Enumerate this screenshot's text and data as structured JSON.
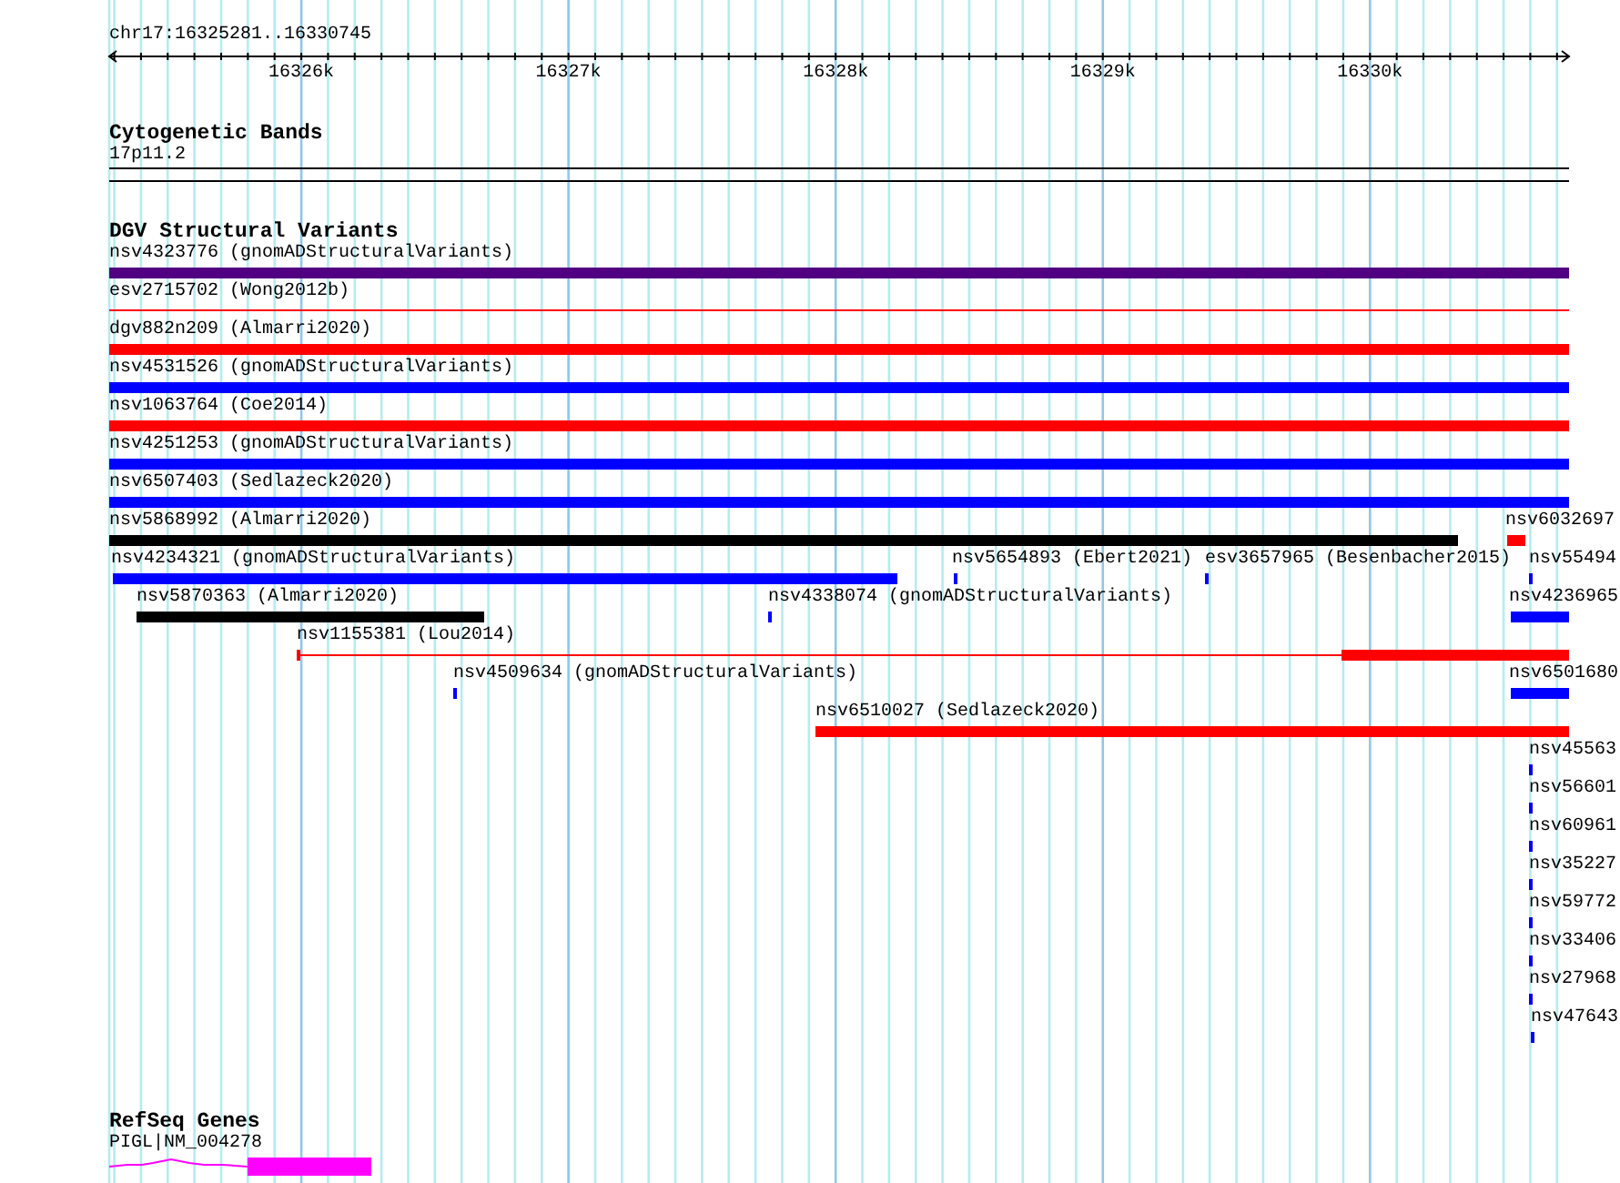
{
  "ruler": {
    "range": "chr17:16325281..16330745",
    "ticks": [
      "16326k",
      "16327k",
      "16328k",
      "16329k",
      "16330k"
    ]
  },
  "cytogenetic_bands": {
    "title": "Cytogenetic Bands",
    "band": "17p11.2"
  },
  "structural_variants": {
    "title": "DGV Structural Variants",
    "features": [
      {
        "label": "nsv4323776 (gnomADStructuralVariants)",
        "color": "#500080",
        "kind": "bar"
      },
      {
        "label": "esv2715702 (Wong2012b)",
        "color": "#ff0000",
        "kind": "line"
      },
      {
        "label": "dgv882n209 (Almarri2020)",
        "color": "#ff0000",
        "kind": "bar"
      },
      {
        "label": "nsv4531526 (gnomADStructuralVariants)",
        "color": "#0000ff",
        "kind": "bar"
      },
      {
        "label": "nsv1063764 (Coe2014)",
        "color": "#ff0000",
        "kind": "bar"
      },
      {
        "label": "nsv4251253 (gnomADStructuralVariants)",
        "color": "#0000ff",
        "kind": "bar"
      },
      {
        "label": "nsv6507403 (Sedlazeck2020)",
        "color": "#0000ff",
        "kind": "bar"
      },
      {
        "label": "nsv5868992 (Almarri2020)",
        "color": "#000000",
        "kind": "bar"
      },
      {
        "label": "nsv6032697",
        "color": "#ff0000",
        "kind": "bar"
      },
      {
        "label": "nsv4234321 (gnomADStructuralVariants)",
        "color": "#0000ff",
        "kind": "bar"
      },
      {
        "label": "nsv5654893 (Ebert2021)",
        "color": "#0000ff",
        "kind": "bar"
      },
      {
        "label": "esv3657965 (Besenbacher2015)",
        "color": "#0000ff",
        "kind": "bar"
      },
      {
        "label": "nsv55494",
        "color": "#0000ff",
        "kind": "bar"
      },
      {
        "label": "nsv5870363 (Almarri2020)",
        "color": "#000000",
        "kind": "bar"
      },
      {
        "label": "nsv4338074 (gnomADStructuralVariants)",
        "color": "#0000ff",
        "kind": "bar"
      },
      {
        "label": "nsv4236965",
        "color": "#0000ff",
        "kind": "bar"
      },
      {
        "label": "nsv1155381 (Lou2014)",
        "color": "#ff0000",
        "kind": "split"
      },
      {
        "label": "nsv4509634 (gnomADStructuralVariants)",
        "color": "#0000ff",
        "kind": "bar"
      },
      {
        "label": "nsv6501680",
        "color": "#0000ff",
        "kind": "bar"
      },
      {
        "label": "nsv6510027 (Sedlazeck2020)",
        "color": "#ff0000",
        "kind": "bar"
      },
      {
        "label": "nsv45563",
        "color": "#0000ff",
        "kind": "bar"
      },
      {
        "label": "nsv56601",
        "color": "#0000ff",
        "kind": "bar"
      },
      {
        "label": "nsv60961",
        "color": "#0000ff",
        "kind": "bar"
      },
      {
        "label": "nsv35227",
        "color": "#0000ff",
        "kind": "bar"
      },
      {
        "label": "nsv59772",
        "color": "#0000ff",
        "kind": "bar"
      },
      {
        "label": "nsv33406",
        "color": "#0000ff",
        "kind": "bar"
      },
      {
        "label": "nsv27968",
        "color": "#0000ff",
        "kind": "bar"
      },
      {
        "label": "nsv47643",
        "color": "#0000ff",
        "kind": "bar"
      }
    ]
  },
  "refseq_genes": {
    "title": "RefSeq Genes",
    "genes": [
      {
        "label": "PIGL|NM_004278",
        "color": "#ff00ff"
      }
    ]
  }
}
